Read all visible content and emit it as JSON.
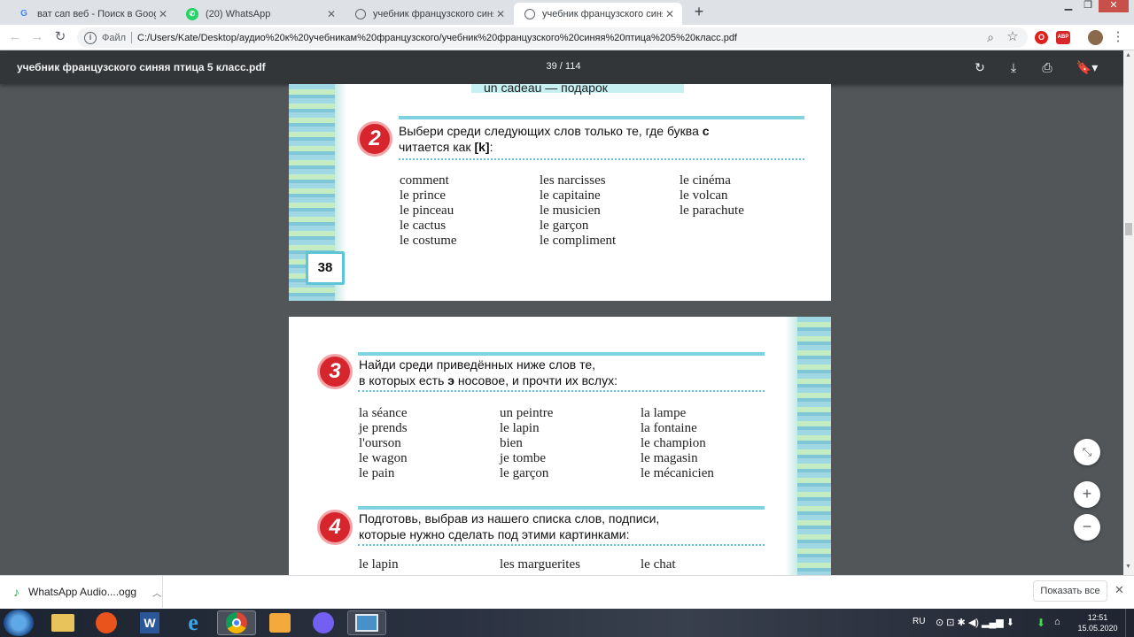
{
  "browser": {
    "tabs": [
      {
        "title": "ват сап веб - Поиск в Google",
        "icon": "google-icon"
      },
      {
        "title": "(20) WhatsApp",
        "icon": "whatsapp-icon"
      },
      {
        "title": "учебник французского синяя пти",
        "icon": "globe-icon"
      },
      {
        "title": "учебник французского синяя пти",
        "icon": "globe-icon"
      }
    ],
    "address_label": "Файл",
    "address_url": "C:/Users/Kate/Desktop/аудио%20к%20учебникам%20французского/учебник%20французского%20синяя%20птица%205%20класс.pdf"
  },
  "pdf": {
    "title": "учебник французского синяя птица 5 класс.pdf",
    "page_indicator": "39 / 114"
  },
  "page1": {
    "top_line": "un cadeau — подарок",
    "task_number": "2",
    "instruction_line1": "Выбери среди следующих слов только те, где буква",
    "instruction_letter": "c",
    "instruction_line2_prefix": "читается как",
    "instruction_sound": "[k]",
    "instruction_line2_suffix": ":",
    "col1": [
      "comment",
      "le prince",
      "le pinceau",
      "le cactus",
      "le costume"
    ],
    "col2": [
      "les narcisses",
      "le capitaine",
      "le musicien",
      "le garçon",
      "le compliment"
    ],
    "col3": [
      "le cinéma",
      "le volcan",
      "le parachute"
    ],
    "page_number": "38"
  },
  "page2": {
    "task3_number": "3",
    "task3_line1": "Найди среди приведённых ниже слов те,",
    "task3_line2_prefix": "в которых есть",
    "task3_sound": "э",
    "task3_line2_suffix": "носовое, и прочти их вслух:",
    "col1": [
      "la séance",
      "je prends",
      "l'ourson",
      "le wagon",
      "le pain"
    ],
    "col2": [
      "un peintre",
      "le lapin",
      "bien",
      "je tombe",
      "le garçon"
    ],
    "col3": [
      "la lampe",
      "la fontaine",
      "le champion",
      "le magasin",
      "le mécanicien"
    ],
    "task4_number": "4",
    "task4_line1": "Подготовь, выбрав из нашего списка слов, подписи,",
    "task4_line2": "которые нужно сделать под этими картинками:",
    "task4_words": [
      "le lapin",
      "les marguerites",
      "le chat"
    ]
  },
  "download": {
    "file": "WhatsApp Audio....ogg",
    "show_all": "Показать все"
  },
  "taskbar": {
    "lang": "RU",
    "time": "12:51",
    "date": "15.05.2020"
  }
}
